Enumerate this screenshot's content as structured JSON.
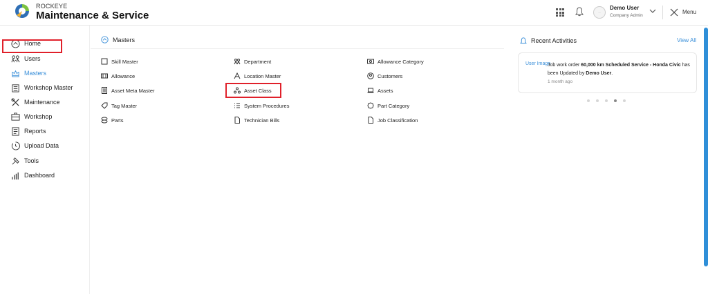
{
  "brand": {
    "small": "ROCKEYE",
    "title": "Maintenance & Service"
  },
  "header": {
    "user_name": "Demo User",
    "user_role": "Company Admin",
    "menu_label": "Menu",
    "avatar_text": "..."
  },
  "sidebar": {
    "items": [
      {
        "label": "Home",
        "icon": "home-icon"
      },
      {
        "label": "Users",
        "icon": "users-icon"
      },
      {
        "label": "Masters",
        "icon": "masters-icon",
        "active": true
      },
      {
        "label": "Workshop Master",
        "icon": "clipboard-icon"
      },
      {
        "label": "Maintenance",
        "icon": "tools-icon"
      },
      {
        "label": "Workshop",
        "icon": "workshop-icon"
      },
      {
        "label": "Reports",
        "icon": "report-icon"
      },
      {
        "label": "Upload Data",
        "icon": "upload-icon"
      },
      {
        "label": "Tools",
        "icon": "hammer-icon"
      },
      {
        "label": "Dashboard",
        "icon": "chart-icon"
      }
    ]
  },
  "main": {
    "title": "Masters",
    "col1": [
      "Skill Master",
      "Allowance",
      "Asset Meta Master",
      "Tag Master",
      "Parts"
    ],
    "col2": [
      "Department",
      "Location Master",
      "Asset Class",
      "System Procedures",
      "Technician Bills"
    ],
    "col3": [
      "Allowance Category",
      "Customers",
      "Assets",
      "Part Category",
      "Job Classification"
    ]
  },
  "recent": {
    "title": "Recent Activities",
    "view_all": "View All",
    "card": {
      "img_alt": "User Image",
      "prefix": "Job work order ",
      "bold1": "60,000 km Scheduled Service - Honda Civic",
      "middle": " has been Updated by ",
      "bold2": "Demo User",
      "suffix": ".",
      "time": "1 month ago"
    },
    "active_dot": 4
  },
  "colors": {
    "accent": "#3a8fd9",
    "highlight": "#e0202a"
  }
}
